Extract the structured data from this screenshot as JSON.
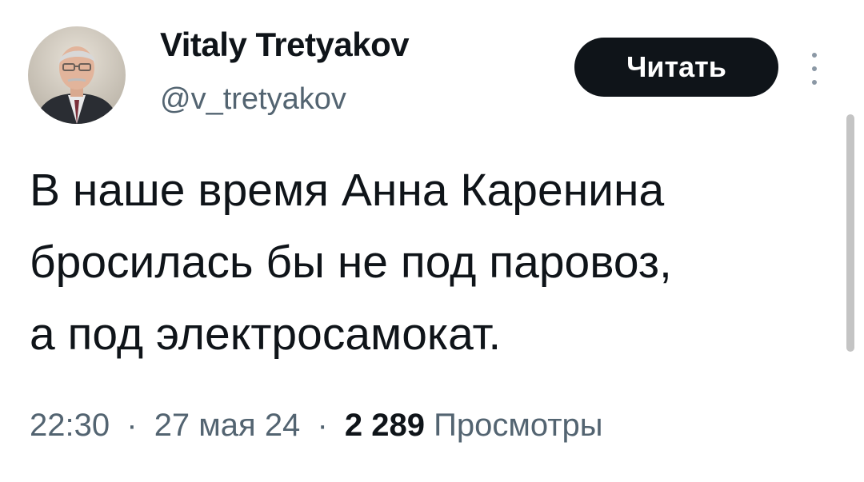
{
  "author": {
    "name": "Vitaly Tretyakov",
    "handle": "@v_tretyakov"
  },
  "actions": {
    "follow_label": "Читать",
    "more_icon": "more-vertical-icon"
  },
  "tweet": {
    "lines": [
      "В наше время Анна Каренина",
      "бросилась бы не под паровоз,",
      "а под электросамокат."
    ]
  },
  "meta": {
    "time": "22:30",
    "date": "27 мая 24",
    "separator": "·",
    "views_count": "2 289",
    "views_label": "Просмотры"
  },
  "colors": {
    "text": "#0f1419",
    "secondary_text": "#536471",
    "button_bg": "#0f1419",
    "button_text": "#ffffff"
  }
}
